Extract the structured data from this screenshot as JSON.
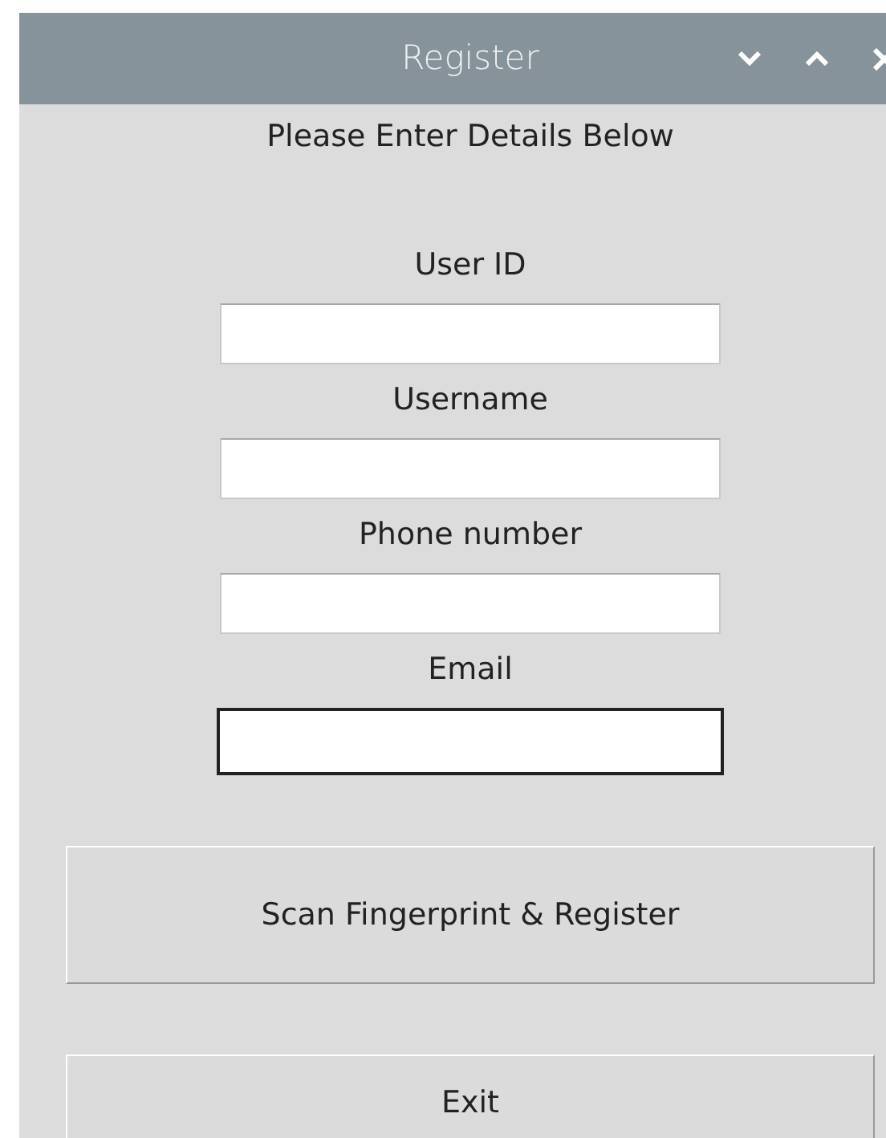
{
  "window": {
    "title": "Register"
  },
  "heading": "Please Enter Details Below",
  "fields": [
    {
      "label": "User ID",
      "focused": false
    },
    {
      "label": "Username",
      "focused": false
    },
    {
      "label": "Phone number",
      "focused": false
    },
    {
      "label": "Email",
      "focused": true
    }
  ],
  "buttons": [
    "Scan Fingerprint & Register",
    "Exit"
  ]
}
